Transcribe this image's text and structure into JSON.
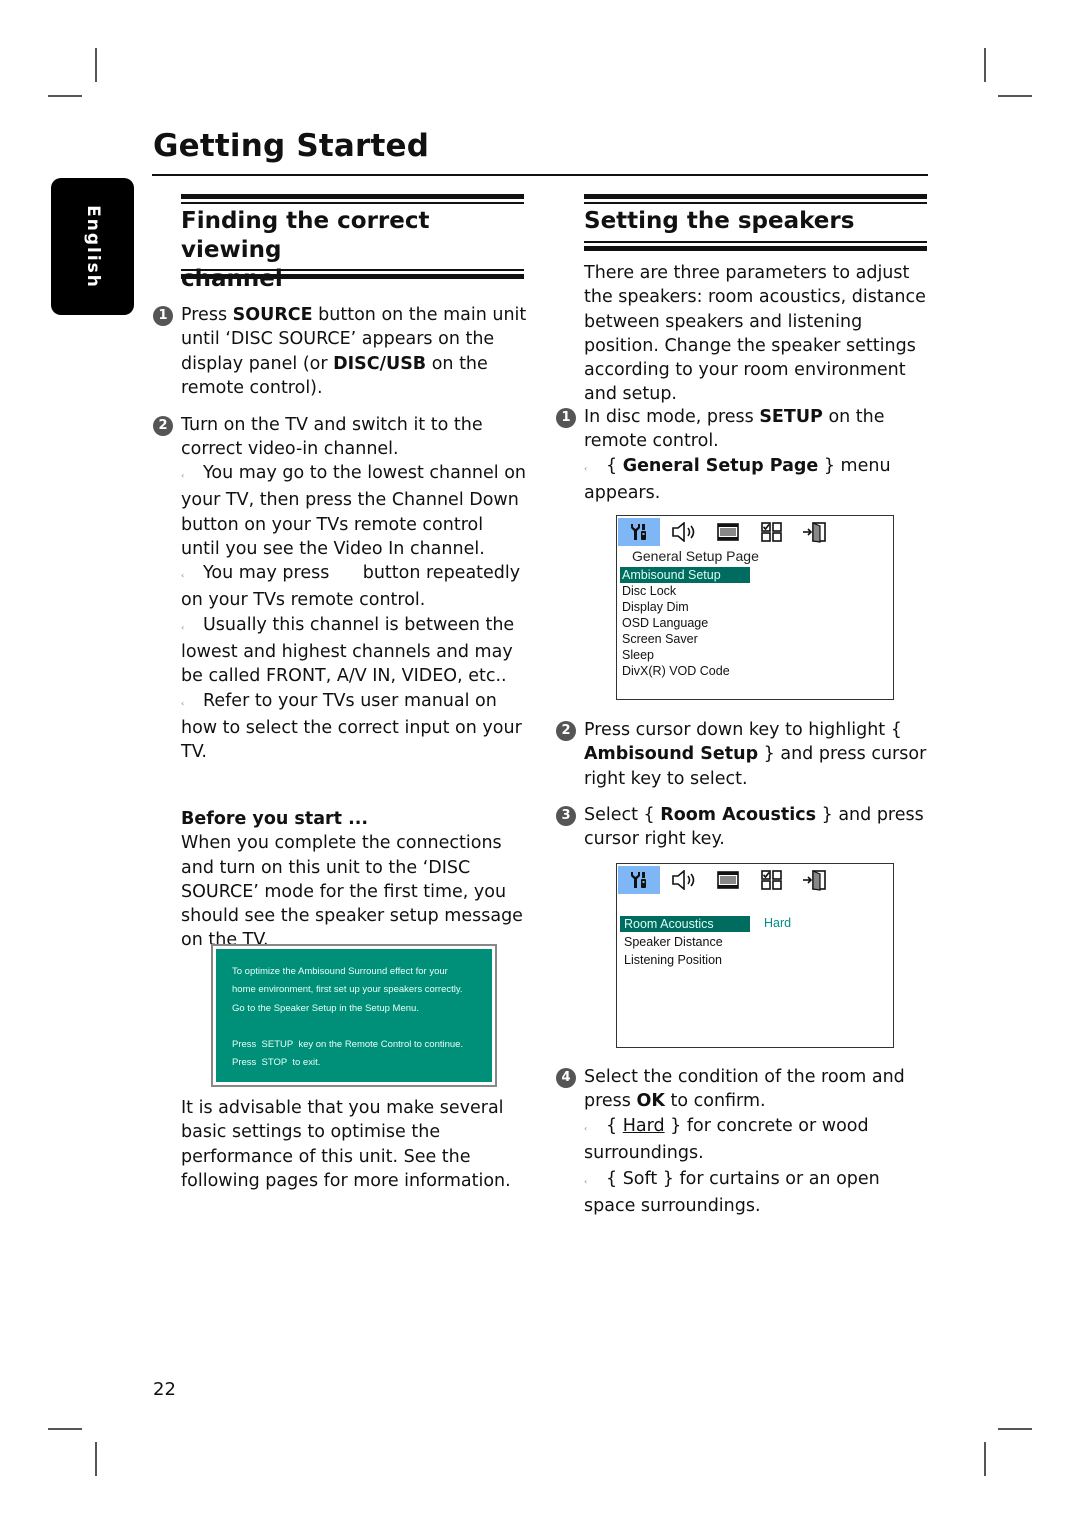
{
  "page": {
    "title": "Getting Started",
    "language_tab": "English",
    "page_number": "22"
  },
  "left": {
    "section_title_line1": "Finding the correct viewing",
    "section_title_line2": "channel",
    "steps": [
      {
        "number": "1",
        "parts": [
          "Press ",
          "SOURCE",
          " button on the main unit until ‘DISC SOURCE’ appears on the display panel (or ",
          "DISC/USB",
          " on the remote control)."
        ]
      },
      {
        "number": "2",
        "text": "Turn on the TV and switch it to the correct video-in channel."
      }
    ],
    "tips": [
      "You may go to the lowest channel on your TV, then press the Channel Down button on your TVs remote control until you see the Video In channel.",
      "You may press      button repeatedly on your TVs remote control.",
      "Usually this channel is between the lowest and highest channels and may be called FRONT, A/V IN, VIDEO, etc..",
      "Refer to your TVs user manual on how to select the correct input on your TV."
    ],
    "before_title": "Before you start ...",
    "before_text": "When you complete the connections and turn on this unit to the ‘DISC SOURCE’ mode for the first time, you should see the speaker setup message on the TV.",
    "osd_message": {
      "line1": "To optimize the Ambisound Surround effect for your",
      "line2": "home environment, first set up your speakers correctly.",
      "line3": "Go to the Speaker Setup in the Setup Menu.",
      "line4": "Press  SETUP  key on the Remote Control to continue.",
      "line5": "Press  STOP  to exit.",
      "bg_color": "#00907a"
    },
    "closing_text": "It is advisable that you make several basic settings to optimise the performance of this unit.  See the following pages for more information."
  },
  "right": {
    "section_title": "Setting the speakers",
    "intro": "There are three parameters to adjust the speakers: room acoustics, distance between speakers and listening position. Change the speaker settings according to your room environment and setup.",
    "step1": {
      "number": "1",
      "a": "In disc mode, press ",
      "b": "SETUP",
      "c": " on the remote control.",
      "tip_open": "{ ",
      "tip_bold": "General Setup Page",
      "tip_close": " } menu appears."
    },
    "menu1": {
      "icons": [
        "tools-icon",
        "speaker-icon",
        "film-icon",
        "grid-icon",
        "exit-door-icon"
      ],
      "subtitle": "General Setup Page",
      "items": [
        "Ambisound Setup",
        "Disc Lock",
        "Display Dim",
        "OSD Language",
        "Screen Saver",
        "Sleep",
        "DivX(R) VOD Code"
      ],
      "highlight_color": "#006b5f",
      "active_tab_color": "#7fb6f5"
    },
    "step2": {
      "number": "2",
      "a": "Press cursor down key to highlight { ",
      "b": "Ambisound Setup",
      "c": " } and press cursor right key to select."
    },
    "step3": {
      "number": "3",
      "a": "Select { ",
      "b": "Room Acoustics",
      "c": " } and press cursor right key."
    },
    "menu2": {
      "items": [
        "Room Acoustics",
        "Speaker Distance",
        "Listening Position"
      ],
      "value": "Hard",
      "value_color": "#008e86"
    },
    "step4": {
      "number": "4",
      "a": "Select the condition of the room and press ",
      "b": "OK",
      "c": " to confirm."
    },
    "options": [
      {
        "open": "{ ",
        "name": "Hard",
        "close": " } for concrete or wood surroundings."
      },
      {
        "open": "{ ",
        "name": "Soft",
        "close": " } for curtains or an open space surroundings."
      }
    ]
  }
}
